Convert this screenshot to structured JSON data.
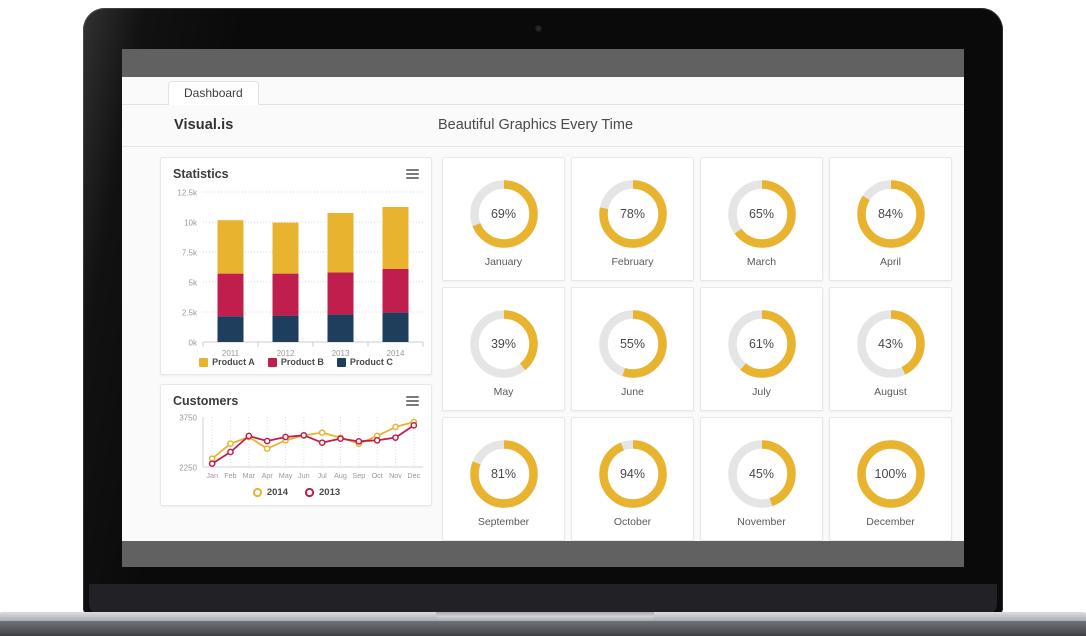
{
  "browser": {
    "tab_label": "Dashboard"
  },
  "header": {
    "brand": "Visual.is",
    "tagline": "Beautiful Graphics Every Time"
  },
  "colors": {
    "product_a": "#e8b430",
    "product_b": "#c01f4e",
    "product_c": "#1f3d5c",
    "donut_fill": "#e8b430",
    "donut_track": "#e5e5e5",
    "series_2014": "#e8b430",
    "series_2013": "#c01f4e",
    "chrome_bar": "#616161",
    "page_bg": "#fafafa"
  },
  "panels": {
    "statistics": {
      "title": "Statistics",
      "menu_icon": "hamburger-menu-icon"
    },
    "customers": {
      "title": "Customers",
      "menu_icon": "hamburger-menu-icon"
    }
  },
  "chart_data": [
    {
      "type": "bar",
      "id": "statistics-stacked-bar",
      "title": "Statistics",
      "stacked": true,
      "categories": [
        "2011",
        "2012",
        "2013",
        "2014"
      ],
      "series": [
        {
          "name": "Product C",
          "color": "#1f3d5c",
          "values": [
            2150,
            2200,
            2300,
            2450
          ]
        },
        {
          "name": "Product B",
          "color": "#c01f4e",
          "values": [
            3550,
            3500,
            3500,
            3650
          ]
        },
        {
          "name": "Product A",
          "color": "#e8b430",
          "values": [
            4450,
            4250,
            4950,
            5150
          ]
        }
      ],
      "totals": [
        10150,
        9950,
        10750,
        11250
      ],
      "ylabel": "",
      "xlabel": "",
      "ylim": [
        0,
        12500
      ],
      "yticks": [
        0,
        2500,
        5000,
        7500,
        10000,
        12500
      ],
      "ytick_labels": [
        "0k",
        "2.5k",
        "5k",
        "7.5k",
        "10k",
        "12.5k"
      ],
      "grid": true,
      "legend_position": "bottom",
      "legend": [
        "Product A",
        "Product B",
        "Product C"
      ]
    },
    {
      "type": "line",
      "id": "customers-line",
      "title": "Customers",
      "categories": [
        "Jan",
        "Feb",
        "Mar",
        "Apr",
        "May",
        "Jun",
        "Jul",
        "Aug",
        "Sep",
        "Oct",
        "Nov",
        "Dec"
      ],
      "series": [
        {
          "name": "2014",
          "color": "#e8b430",
          "values": [
            2500,
            2950,
            3150,
            2800,
            3050,
            3200,
            3280,
            3130,
            2950,
            3180,
            3450,
            3600
          ]
        },
        {
          "name": "2013",
          "color": "#c01f4e",
          "values": [
            2350,
            2700,
            3180,
            3030,
            3150,
            3200,
            2980,
            3100,
            3020,
            3050,
            3130,
            3500
          ]
        }
      ],
      "ylabel": "",
      "xlabel": "",
      "ylim": [
        2250,
        3750
      ],
      "yticks": [
        2250,
        3750
      ],
      "ytick_labels": [
        "2250",
        "3750"
      ],
      "grid": true,
      "legend_position": "bottom",
      "legend": [
        "2014",
        "2013"
      ]
    },
    {
      "type": "pie",
      "id": "monthly-completion-donuts",
      "subtype": "donut-grid",
      "title": "",
      "categories": [
        "January",
        "February",
        "March",
        "April",
        "May",
        "June",
        "July",
        "August",
        "September",
        "October",
        "November",
        "December"
      ],
      "values": [
        69,
        78,
        65,
        84,
        39,
        55,
        61,
        43,
        81,
        94,
        45,
        100
      ],
      "value_labels": [
        "69%",
        "78%",
        "65%",
        "84%",
        "39%",
        "55%",
        "61%",
        "43%",
        "81%",
        "94%",
        "45%",
        "100%"
      ],
      "unit": "%",
      "ylim": [
        0,
        100
      ]
    }
  ]
}
